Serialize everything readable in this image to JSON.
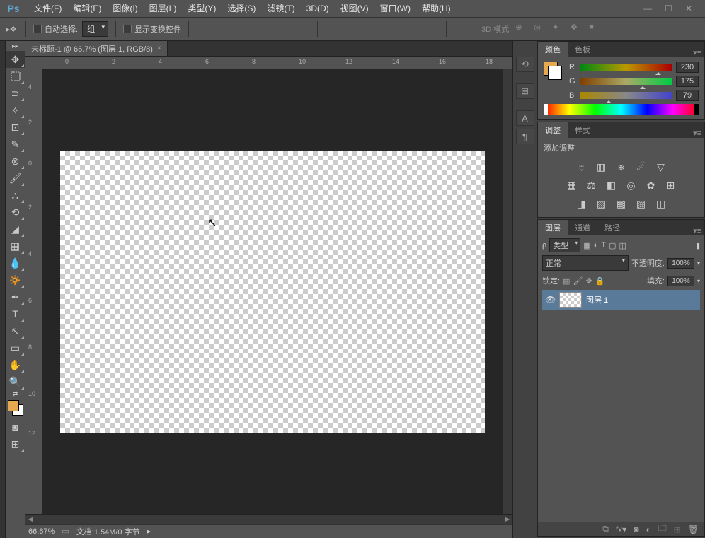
{
  "menubar": {
    "items": [
      "文件(F)",
      "编辑(E)",
      "图像(I)",
      "图层(L)",
      "类型(Y)",
      "选择(S)",
      "滤镜(T)",
      "3D(D)",
      "视图(V)",
      "窗口(W)",
      "帮助(H)"
    ]
  },
  "options_bar": {
    "auto_select": "自动选择:",
    "group": "组",
    "show_transform": "显示变换控件",
    "mode_3d": "3D 模式:"
  },
  "tab": {
    "title": "未标题-1 @ 66.7% (图层 1, RGB/8)"
  },
  "ruler_h": [
    "0",
    "2",
    "4",
    "6",
    "8",
    "10",
    "12",
    "14",
    "16",
    "18"
  ],
  "ruler_v": [
    "0",
    "2",
    "4",
    "2",
    "4",
    "6",
    "8",
    "10",
    "12"
  ],
  "status": {
    "zoom": "66.67%",
    "info": "文档:1.54M/0 字节"
  },
  "color_panel": {
    "tabs": [
      "颜色",
      "色板"
    ],
    "r_label": "R",
    "r_val": "230",
    "g_label": "G",
    "g_val": "175",
    "b_label": "B",
    "b_val": "79"
  },
  "adjust_panel": {
    "tabs": [
      "调整",
      "样式"
    ],
    "title": "添加调整"
  },
  "layers_panel": {
    "tabs": [
      "图层",
      "通道",
      "路径"
    ],
    "type_label": "类型",
    "blend_mode": "正常",
    "opacity_label": "不透明度:",
    "opacity_val": "100%",
    "lock_label": "锁定:",
    "fill_label": "填充:",
    "fill_val": "100%",
    "layer1_name": "图层 1"
  }
}
